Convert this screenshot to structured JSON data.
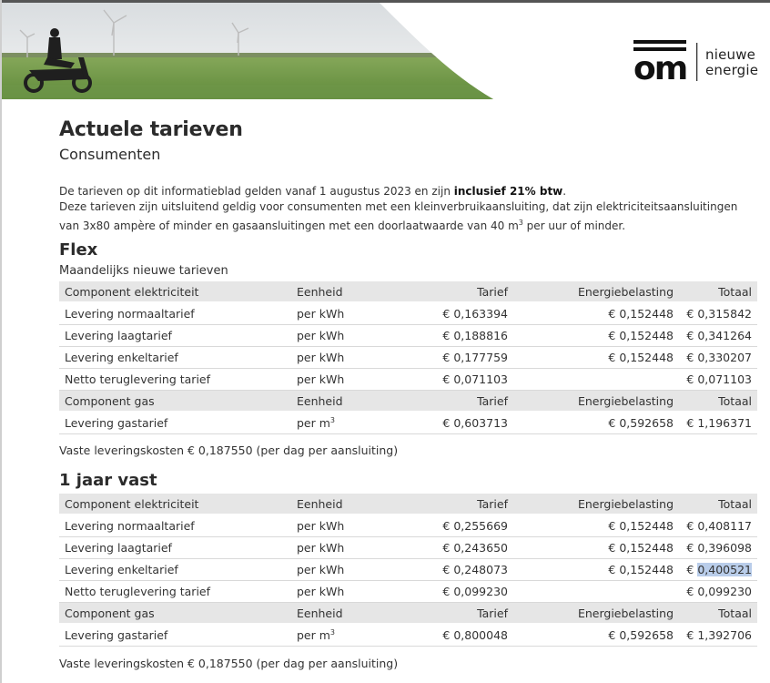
{
  "logo": {
    "mark": "om",
    "line1": "nieuwe",
    "line2": "energie"
  },
  "title": "Actuele tarieven",
  "subtitle": "Consumenten",
  "intro": {
    "p1_before": "De tarieven op dit informatieblad gelden vanaf 1 augustus 2023 en zijn ",
    "p1_bold": "inclusief 21% btw",
    "p1_after": ".",
    "p2": "Deze tarieven zijn uitsluitend geldig voor consumenten met een kleinverbruikaansluiting, dat zijn elektriciteitsaansluitingen van 3x80 ampère of minder en gasaansluitingen met een doorlaatwaarde van 40 m",
    "p2_sup": "3",
    "p2_after": " per uur of minder."
  },
  "flex": {
    "title": "Flex",
    "subtitle": "Maandelijks nieuwe tarieven",
    "elec_header": [
      "Component elektriciteit",
      "Eenheid",
      "Tarief",
      "Energiebelasting",
      "Totaal"
    ],
    "elec_rows": [
      [
        "Levering normaaltarief",
        "per kWh",
        "€ 0,163394",
        "€ 0,152448",
        "€ 0,315842"
      ],
      [
        "Levering laagtarief",
        "per kWh",
        "€ 0,188816",
        "€ 0,152448",
        "€ 0,341264"
      ],
      [
        "Levering enkeltarief",
        "per kWh",
        "€ 0,177759",
        "€ 0,152448",
        "€ 0,330207"
      ],
      [
        "Netto teruglevering tarief",
        "per kWh",
        "€ 0,071103",
        "",
        "€ 0,071103"
      ]
    ],
    "gas_header": [
      "Component gas",
      "Eenheid",
      "Tarief",
      "Energiebelasting",
      "Totaal"
    ],
    "gas_row": {
      "name": "Levering gastarief",
      "unit": "per m",
      "unit_sup": "3",
      "tarief": "€ 0,603713",
      "belasting": "€ 0,592658",
      "totaal": "€ 1,196371"
    },
    "fixed": "Vaste leveringskosten € 0,187550 (per dag per aansluiting)"
  },
  "vast": {
    "title": "1 jaar vast",
    "elec_header": [
      "Component elektriciteit",
      "Eenheid",
      "Tarief",
      "Energiebelasting",
      "Totaal"
    ],
    "elec_rows": [
      [
        "Levering normaaltarief",
        "per kWh",
        "€ 0,255669",
        "€ 0,152448",
        "€ 0,408117"
      ],
      [
        "Levering laagtarief",
        "per kWh",
        "€ 0,243650",
        "€ 0,152448",
        "€ 0,396098"
      ],
      [
        "Levering enkeltarief",
        "per kWh",
        "€ 0,248073",
        "€ 0,152448",
        "€ 0,400521"
      ],
      [
        "Netto teruglevering tarief",
        "per kWh",
        "€ 0,099230",
        "",
        "€ 0,099230"
      ]
    ],
    "selected_cell": {
      "prefix": "€ ",
      "value": "0,400521"
    },
    "gas_header": [
      "Component gas",
      "Eenheid",
      "Tarief",
      "Energiebelasting",
      "Totaal"
    ],
    "gas_row": {
      "name": "Levering gastarief",
      "unit": "per m",
      "unit_sup": "3",
      "tarief": "€ 0,800048",
      "belasting": "€ 0,592658",
      "totaal": "€ 1,392706"
    },
    "fixed": "Vaste leveringskosten € 0,187550 (per dag per aansluiting)"
  }
}
